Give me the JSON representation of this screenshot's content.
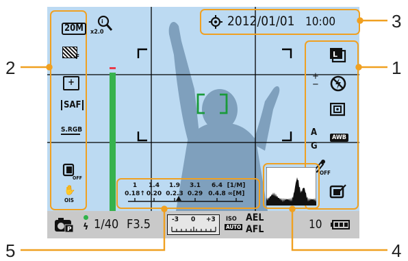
{
  "datetime": {
    "date": "2012/01/01",
    "time": "10:00"
  },
  "left_icons": {
    "size": "20M",
    "digital_zoom": "x2.0",
    "quality": "F",
    "ev": "+",
    "af_mode": "SAF",
    "color_space": "S.RGB",
    "drive": "OFF",
    "ois": "OIS"
  },
  "right_icons": {
    "flash_pm": "+\n−",
    "ag_a": "A",
    "ag_g": "G",
    "awb": "AWB",
    "picture_wizard": "OFF"
  },
  "af_distances": {
    "row1": [
      "1",
      "1.4",
      "1.9",
      "3.1",
      "6.4",
      "[1/M]"
    ],
    "row2": [
      "0.18↑",
      "0.20",
      "0.2.3",
      "0.29",
      "0.4.8",
      "∞[M]"
    ]
  },
  "status": {
    "shutter": "1/40",
    "aperture": "F3.5",
    "ev_scale": [
      "-3",
      "0",
      "+3"
    ],
    "iso_top": "ISO",
    "iso_bottom": "AUTO",
    "ael": "AEL",
    "afl": "AFL",
    "shots": "10"
  },
  "callouts": [
    "1",
    "2",
    "3",
    "4",
    "5"
  ],
  "colors": {
    "accent": "#f0a020",
    "screen_bg": "#bcdaf2",
    "status_bg": "#c9c9c9",
    "battery": "#111111"
  }
}
